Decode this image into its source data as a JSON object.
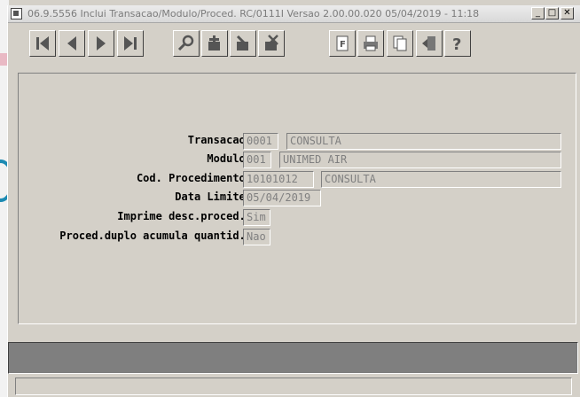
{
  "window": {
    "title": "06.9.5556  Inclui Transacao/Modulo/Proced. RC/0111I Versao 2.00.00.020 05/04/2019 - 11:18",
    "controls": {
      "minimize": "_",
      "maximize": "□",
      "close": "✕"
    }
  },
  "toolbar": {
    "nav": [
      "first-icon",
      "previous-icon",
      "next-icon",
      "last-icon"
    ],
    "edit": [
      "search-icon",
      "add-icon",
      "edit-icon",
      "delete-icon"
    ],
    "tools": [
      "filter-icon",
      "print-icon",
      "copy-icon",
      "exit-icon",
      "help-icon"
    ]
  },
  "form": {
    "transacao": {
      "label": "Transacao:",
      "code": "0001",
      "desc": "CONSULTA"
    },
    "modulo": {
      "label": "Modulo:",
      "code": "001",
      "desc": "UNIMED AIR"
    },
    "procedimento": {
      "label": "Cod. Procedimento:",
      "code": "10101012",
      "desc": "CONSULTA"
    },
    "data_limite": {
      "label": "Data Limite:",
      "value": "05/04/2019"
    },
    "imprime": {
      "label": "Imprime desc.proced.:",
      "value": "Sim"
    },
    "duplo": {
      "label": "Proced.duplo acumula quantid.:",
      "value": "Nao"
    }
  },
  "status": {
    "message": "",
    "text": ""
  }
}
